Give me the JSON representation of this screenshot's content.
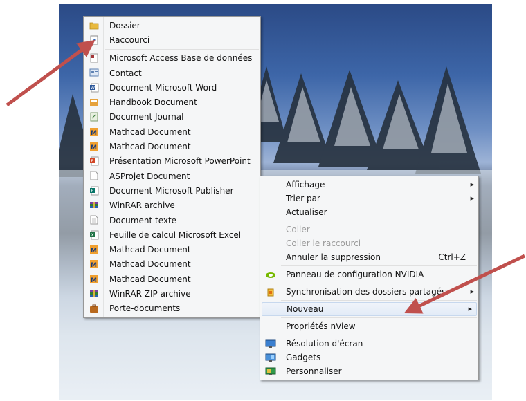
{
  "new_submenu": {
    "items": [
      {
        "label": "Dossier",
        "icon": "folder-icon"
      },
      {
        "label": "Raccourci",
        "icon": "shortcut-icon"
      },
      {
        "label": "Microsoft Access Base de données",
        "icon": "access-icon"
      },
      {
        "label": "Contact",
        "icon": "contact-icon"
      },
      {
        "label": "Document Microsoft Word",
        "icon": "word-icon"
      },
      {
        "label": "Handbook Document",
        "icon": "handbook-icon"
      },
      {
        "label": "Document Journal",
        "icon": "journal-icon"
      },
      {
        "label": "Mathcad Document",
        "icon": "mathcad-icon"
      },
      {
        "label": "Mathcad Document",
        "icon": "mathcad-icon"
      },
      {
        "label": "Présentation Microsoft PowerPoint",
        "icon": "powerpoint-icon"
      },
      {
        "label": "ASProjet Document",
        "icon": "blank-document-icon"
      },
      {
        "label": "Document Microsoft Publisher",
        "icon": "publisher-icon"
      },
      {
        "label": "WinRAR archive",
        "icon": "winrar-icon"
      },
      {
        "label": "Document texte",
        "icon": "text-document-icon"
      },
      {
        "label": "Feuille de calcul Microsoft Excel",
        "icon": "excel-icon"
      },
      {
        "label": "Mathcad Document",
        "icon": "mathcad-icon"
      },
      {
        "label": "Mathcad Document",
        "icon": "mathcad-icon"
      },
      {
        "label": "Mathcad Document",
        "icon": "mathcad-icon"
      },
      {
        "label": "WinRAR ZIP archive",
        "icon": "winrar-zip-icon"
      },
      {
        "label": "Porte-documents",
        "icon": "briefcase-icon"
      }
    ]
  },
  "context_menu": {
    "view": "Affichage",
    "sort_by": "Trier par",
    "refresh": "Actualiser",
    "paste": "Coller",
    "paste_shortcut": "Coller le raccourci",
    "undo_delete": "Annuler la suppression",
    "undo_shortcut": "Ctrl+Z",
    "nvidia_panel": "Panneau de configuration NVIDIA",
    "sync_shared": "Synchronisation des dossiers partagés",
    "new": "Nouveau",
    "nview_properties": "Propriétés nView",
    "screen_resolution": "Résolution d'écran",
    "gadgets": "Gadgets",
    "personalize": "Personnaliser"
  },
  "colors": {
    "annotation_arrow": "#c0504d",
    "menu_background": "#f5f6f7",
    "menu_border": "#979797",
    "disabled_text": "#9a9a9a"
  }
}
